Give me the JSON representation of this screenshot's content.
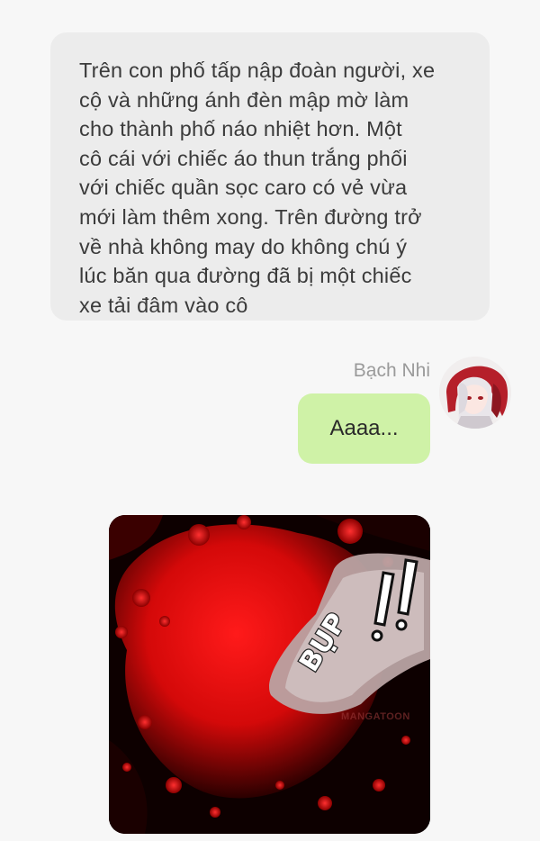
{
  "narration": {
    "lines": [
      "Trên con phố tấp nập đoàn người, xe",
      "cộ và những ánh đèn mập mờ làm",
      "cho thành phố náo nhiệt hơn. Một",
      "cô cái với chiếc áo thun trắng phối",
      "với chiếc quần sọc caro có vẻ vừa",
      "mới làm thêm xong. Trên đường trở",
      "về nhà không may do không chú ý",
      "lúc băn qua đường đã bị một chiếc",
      "xe tải đâm vào cô"
    ]
  },
  "message": {
    "sender": "Bạch Nhi",
    "text": "Aaaa...",
    "bubble_color": "#cff2a7"
  },
  "image": {
    "sfx_text": "BỤP",
    "watermark": "MANGATOON"
  }
}
